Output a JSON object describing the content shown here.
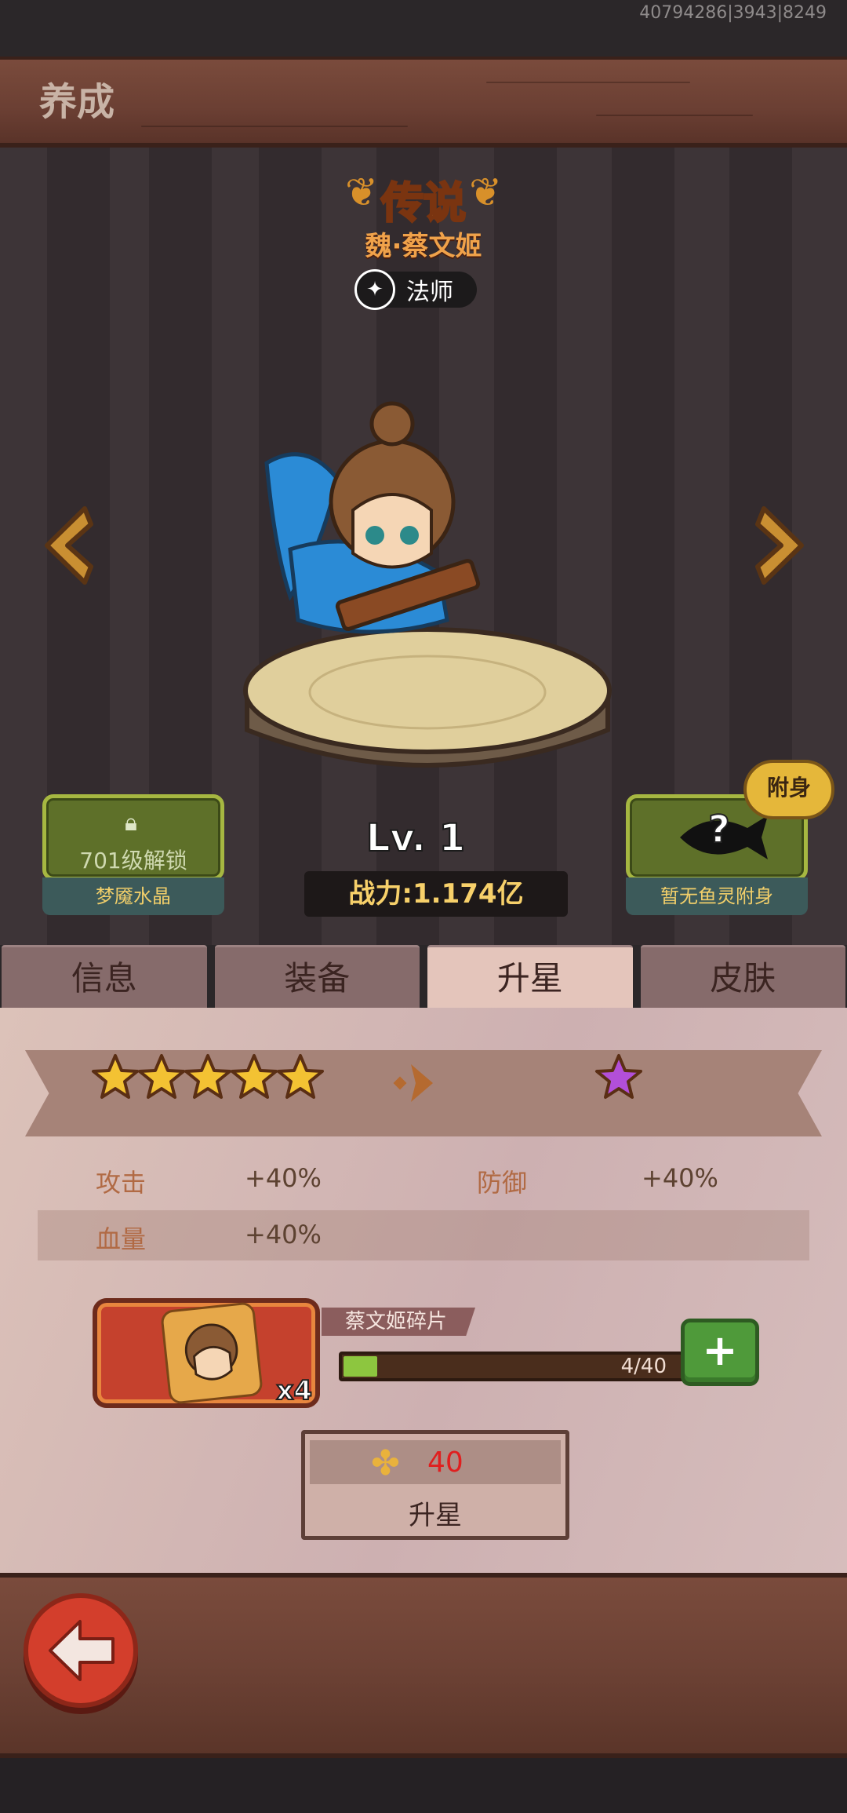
{
  "debug_id": "40794286|3943|8249",
  "header": {
    "title": "养成"
  },
  "hero": {
    "rarity": "传说",
    "name": "魏·蔡文姬",
    "class_label": "法师",
    "level": "Lv. 1",
    "power": "战力:1.174亿"
  },
  "left_slot": {
    "unlock_text": "701级解锁",
    "caption": "梦魇水晶"
  },
  "right_slot": {
    "glyph": "?",
    "badge": "附身",
    "caption": "暂无鱼灵附身"
  },
  "tabs": [
    {
      "label": "信息",
      "active": false
    },
    {
      "label": "装备",
      "active": false
    },
    {
      "label": "升星",
      "active": true
    },
    {
      "label": "皮肤",
      "active": false
    }
  ],
  "star_upgrade": {
    "current_stars": 5,
    "current_star_color": "#f3c233",
    "next_star_color": "#b24fd8",
    "stats": [
      {
        "label": "攻击",
        "value": "+40%"
      },
      {
        "label": "防御",
        "value": "+40%"
      },
      {
        "label": "血量",
        "value": "+40%"
      }
    ],
    "shard": {
      "name": "蔡文姬碎片",
      "count_badge": "x4",
      "progress_label": "4/40",
      "progress_fraction": 0.1,
      "add_label": "+"
    },
    "upgrade_button": {
      "cost": "40",
      "label": "升星"
    }
  }
}
